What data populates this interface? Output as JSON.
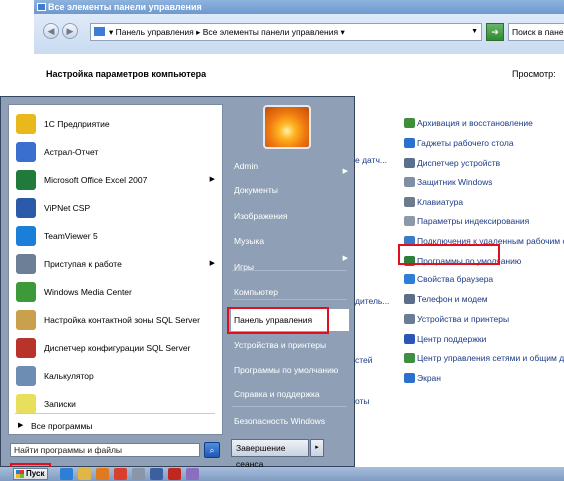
{
  "window": {
    "title": "Все элементы панели управления",
    "address": "▾ Панель управления ▸ Все элементы панели управления ▾",
    "search_placeholder": "Поиск в пане",
    "header_title": "Настройка параметров компьютера",
    "view_label": "Просмотр:"
  },
  "control_panel": {
    "items": [
      {
        "label": "Архивация и восстановление",
        "color": "#3f8f3a"
      },
      {
        "label": "Гаджеты рабочего стола",
        "color": "#2b6fcf"
      },
      {
        "label": "Диспетчер устройств",
        "color": "#5b6f8e"
      },
      {
        "label": "Защитник Windows",
        "color": "#7f8fa5"
      },
      {
        "label": "Клавиатура",
        "color": "#6e7b8c"
      },
      {
        "label": "Параметры индексирования",
        "color": "#8d98a8"
      },
      {
        "label": "Подключения к удаленным рабочим с...",
        "color": "#3b79c9"
      },
      {
        "label": "Программы по умолчанию",
        "color": "#2f7d3a"
      },
      {
        "label": "Свойства браузера",
        "color": "#2d7ed7"
      },
      {
        "label": "Телефон и модем",
        "color": "#5c6f88"
      },
      {
        "label": "Устройства и принтеры",
        "color": "#6b7d95"
      },
      {
        "label": "Центр поддержки",
        "color": "#2a56b8"
      },
      {
        "label": "Центр управления сетями и общим д...",
        "color": "#3e8f42"
      },
      {
        "label": "Экран",
        "color": "#2b6fcf"
      }
    ],
    "partial_texts": [
      "е датч...",
      "дитель...",
      "стей",
      "оты"
    ]
  },
  "start_menu": {
    "programs": [
      {
        "label": "1С Предприятие",
        "icon": "1c-icon",
        "color": "#e8b81c",
        "arrow": false
      },
      {
        "label": "Астрал-Отчет",
        "icon": "astral-icon",
        "color": "#3a6fd0",
        "arrow": false
      },
      {
        "label": "Microsoft Office Excel 2007",
        "icon": "excel-icon",
        "color": "#1f7a3c",
        "arrow": true
      },
      {
        "label": "ViPNet CSP",
        "icon": "vipnet-icon",
        "color": "#2c5aa8",
        "arrow": false
      },
      {
        "label": "TeamViewer 5",
        "icon": "teamviewer-icon",
        "color": "#1b7fd9",
        "arrow": false
      },
      {
        "label": "Приступая к работе",
        "icon": "getting-started-icon",
        "color": "#6c7f97",
        "arrow": true
      },
      {
        "label": "Windows Media Center",
        "icon": "media-center-icon",
        "color": "#3d9a3a",
        "arrow": false
      },
      {
        "label": "Настройка контактной зоны SQL Server",
        "icon": "sql-lock-icon",
        "color": "#c9a14c",
        "arrow": false
      },
      {
        "label": "Диспетчер конфигурации SQL Server",
        "icon": "sql-config-icon",
        "color": "#b8332a",
        "arrow": false
      },
      {
        "label": "Калькулятор",
        "icon": "calculator-icon",
        "color": "#6e8db3",
        "arrow": false
      },
      {
        "label": "Записки",
        "icon": "sticky-notes-icon",
        "color": "#e8e05c",
        "arrow": false
      }
    ],
    "all_programs": "Все программы",
    "search_placeholder": "Найти программы и файлы",
    "right_items": [
      {
        "label": "Admin",
        "arrow": false
      },
      {
        "label": "Документы",
        "arrow": false
      },
      {
        "label": "Изображения",
        "arrow": false
      },
      {
        "label": "Музыка",
        "arrow": false
      },
      {
        "label": "Игры",
        "arrow": false
      },
      {
        "label": "Компьютер",
        "arrow": false
      },
      {
        "label": "Панель управления",
        "arrow": false
      },
      {
        "label": "Устройства и принтеры",
        "arrow": false
      },
      {
        "label": "Программы по умолчанию",
        "arrow": false
      },
      {
        "label": "Справка и поддержка",
        "arrow": false
      },
      {
        "label": "Безопасность Windows",
        "arrow": false
      }
    ],
    "shutdown_label": "Завершение сеанса",
    "shutdown_arrow": "▸"
  },
  "taskbar": {
    "start_label": "Пуск",
    "icons": [
      {
        "name": "ie-icon",
        "color": "#2d7ed7"
      },
      {
        "name": "explorer-icon",
        "color": "#e2b646"
      },
      {
        "name": "media-player-icon",
        "color": "#e07a1e"
      },
      {
        "name": "chrome-icon",
        "color": "#d8402e"
      },
      {
        "name": "tool-icon",
        "color": "#8a96a8"
      },
      {
        "name": "app-icon",
        "color": "#3d5fa0"
      },
      {
        "name": "pdf-icon",
        "color": "#c0281f"
      },
      {
        "name": "star-icon",
        "color": "#8a6fbf"
      }
    ]
  }
}
